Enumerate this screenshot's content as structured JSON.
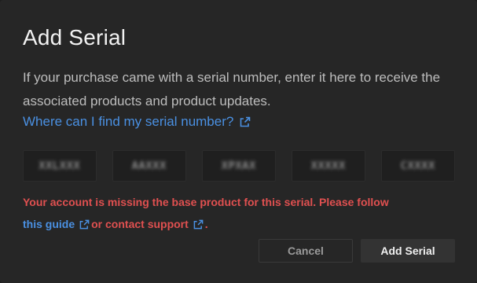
{
  "dialog": {
    "title": "Add Serial",
    "description": "If your purchase came with a serial number, enter it here to receive the associated products and product updates.",
    "help_link": "Where can I find my serial number?",
    "serial_fields": [
      "XXLXXX",
      "AAXXX",
      "XPXAX",
      "XXXXX",
      "CXXXX"
    ],
    "error": {
      "message": "Your account is missing the base product for this serial. Please follow",
      "guide_link": "this guide",
      "or_text": "or contact support",
      "trailing": "."
    },
    "buttons": {
      "cancel": "Cancel",
      "add": "Add Serial"
    }
  },
  "colors": {
    "background": "#262626",
    "link": "#4a90e2",
    "error": "#e05050"
  },
  "icons": {
    "external_link": "external-link-icon"
  }
}
